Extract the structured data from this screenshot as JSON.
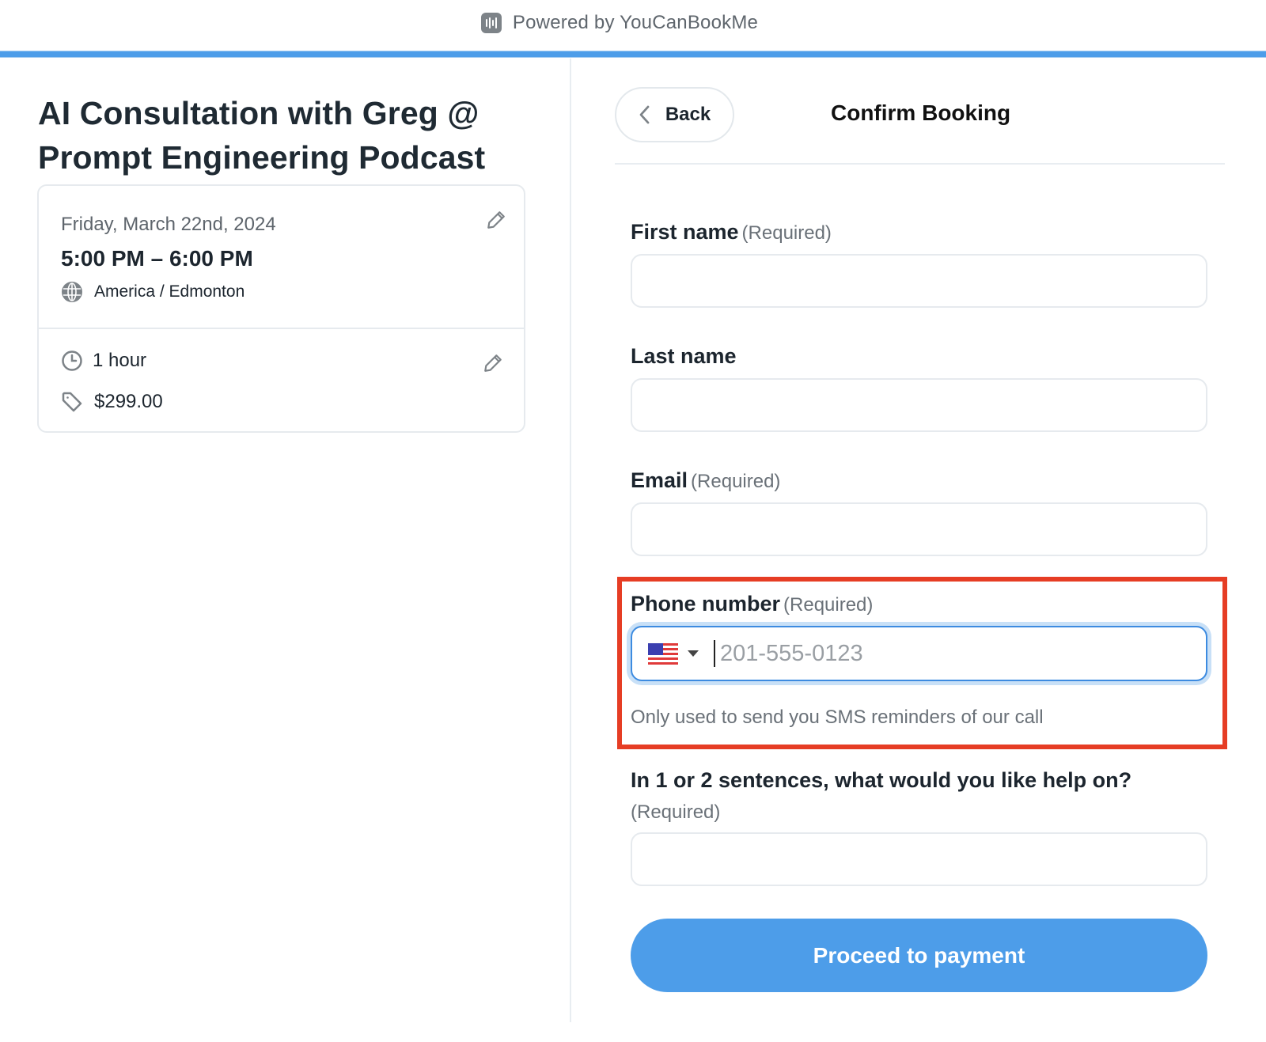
{
  "header": {
    "powered_by": "Powered by YouCanBookMe",
    "brand_icon": "youcanbookme-logo-icon",
    "progress_bar_color": "#4d9de9"
  },
  "event": {
    "title": "AI Consultation with Greg @ Prompt Engineering Podcast",
    "date": "Friday, March 22nd, 2024",
    "time_range": "5:00 PM – 6:00 PM",
    "timezone": "America / Edmonton",
    "duration": "1 hour",
    "price": "$299.00",
    "icons": {
      "timezone": "globe-icon",
      "duration": "clock-icon",
      "price": "tag-icon",
      "edit": "pencil-icon"
    }
  },
  "form": {
    "back_label": "Back",
    "title": "Confirm Booking",
    "fields": [
      {
        "label": "First name",
        "required_note": "(Required)",
        "value": "",
        "placeholder": ""
      },
      {
        "label": "Last name",
        "required_note": "",
        "value": "",
        "placeholder": ""
      },
      {
        "label": "Email",
        "required_note": "(Required)",
        "value": "",
        "placeholder": ""
      },
      {
        "label": "Phone number",
        "required_note": "(Required)",
        "value": "",
        "placeholder": "201-555-0123",
        "country": "US",
        "help": "Only used to send you SMS reminders of our call"
      },
      {
        "label": "In 1 or 2 sentences, what would you like help on?",
        "required_note": "(Required)",
        "value": "",
        "placeholder": ""
      }
    ],
    "submit_label": "Proceed to payment",
    "accent_color": "#4d9de9",
    "highlight_color": "#e63d24"
  }
}
